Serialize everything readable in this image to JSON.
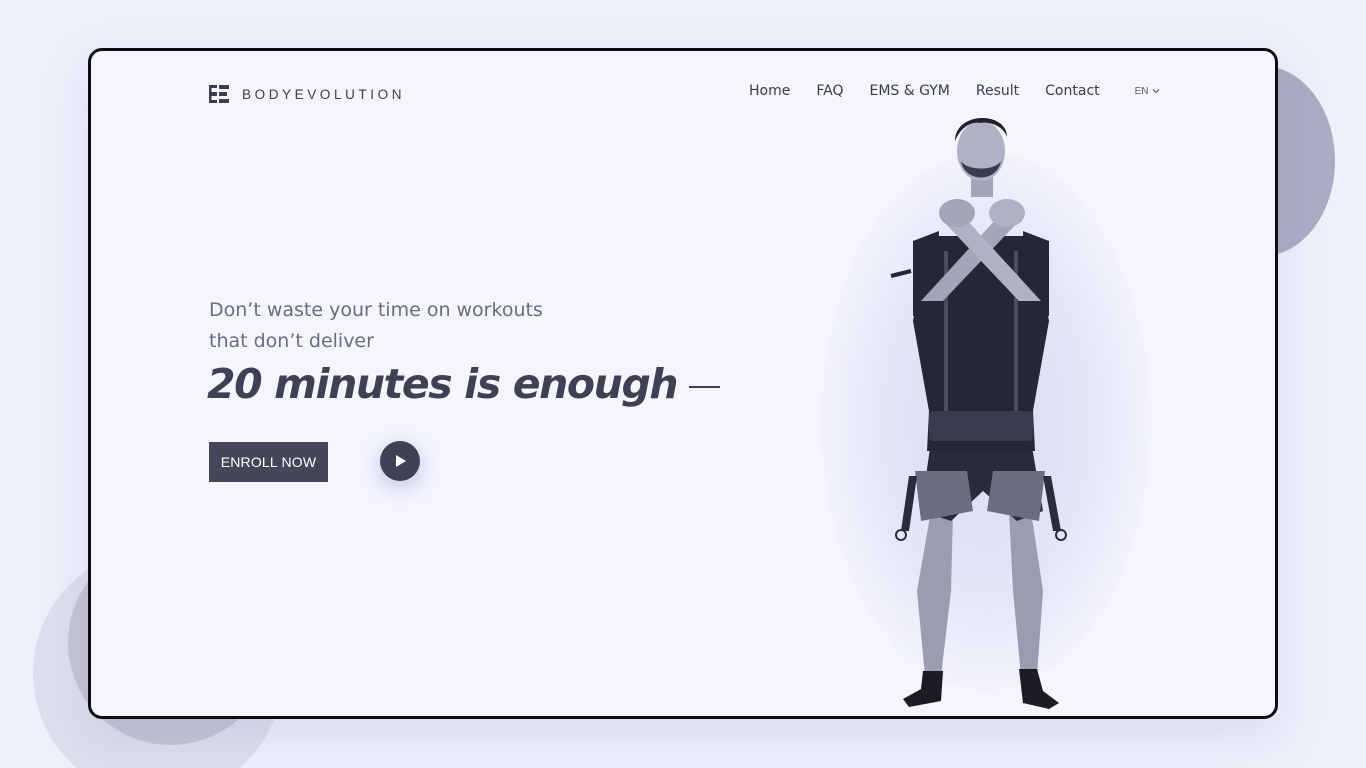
{
  "brand": {
    "name": "BODYEVOLUTION",
    "logo_icon": "be-monogram-icon"
  },
  "nav": {
    "items": [
      {
        "label": "Home"
      },
      {
        "label": "FAQ"
      },
      {
        "label": "EMS & GYM"
      },
      {
        "label": "Result"
      },
      {
        "label": "Contact"
      }
    ],
    "language": {
      "label": "EN",
      "icon": "chevron-down-icon"
    }
  },
  "hero": {
    "subtitle_line1": "Don’t waste your time on workouts",
    "subtitle_line2": "that don’t deliver",
    "title": "20 minutes is enough",
    "cta_label": "ENROLL NOW",
    "play_icon": "play-icon",
    "image_icon": "athlete-ems-suit-illustration"
  },
  "colors": {
    "background": "#eef0fb",
    "frame": "#f4f5fe",
    "frame_border": "#0d0d12",
    "primary_dark": "#444659",
    "text_dark": "#3e4053",
    "text_muted": "#6a6d82",
    "deco_circle": "#a9acc2"
  }
}
